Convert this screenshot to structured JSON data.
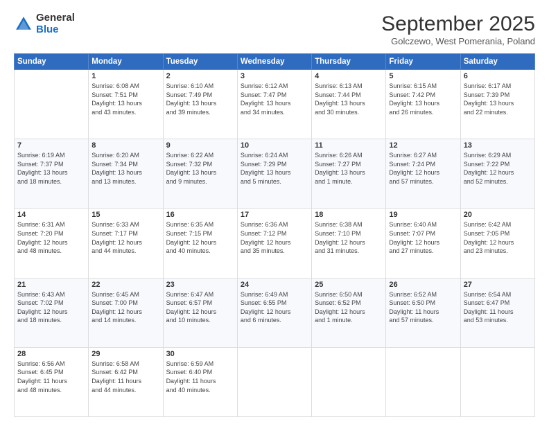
{
  "logo": {
    "general": "General",
    "blue": "Blue"
  },
  "header": {
    "month": "September 2025",
    "location": "Golczewo, West Pomerania, Poland"
  },
  "days_of_week": [
    "Sunday",
    "Monday",
    "Tuesday",
    "Wednesday",
    "Thursday",
    "Friday",
    "Saturday"
  ],
  "weeks": [
    [
      {
        "day": "",
        "info": ""
      },
      {
        "day": "1",
        "info": "Sunrise: 6:08 AM\nSunset: 7:51 PM\nDaylight: 13 hours\nand 43 minutes."
      },
      {
        "day": "2",
        "info": "Sunrise: 6:10 AM\nSunset: 7:49 PM\nDaylight: 13 hours\nand 39 minutes."
      },
      {
        "day": "3",
        "info": "Sunrise: 6:12 AM\nSunset: 7:47 PM\nDaylight: 13 hours\nand 34 minutes."
      },
      {
        "day": "4",
        "info": "Sunrise: 6:13 AM\nSunset: 7:44 PM\nDaylight: 13 hours\nand 30 minutes."
      },
      {
        "day": "5",
        "info": "Sunrise: 6:15 AM\nSunset: 7:42 PM\nDaylight: 13 hours\nand 26 minutes."
      },
      {
        "day": "6",
        "info": "Sunrise: 6:17 AM\nSunset: 7:39 PM\nDaylight: 13 hours\nand 22 minutes."
      }
    ],
    [
      {
        "day": "7",
        "info": "Sunrise: 6:19 AM\nSunset: 7:37 PM\nDaylight: 13 hours\nand 18 minutes."
      },
      {
        "day": "8",
        "info": "Sunrise: 6:20 AM\nSunset: 7:34 PM\nDaylight: 13 hours\nand 13 minutes."
      },
      {
        "day": "9",
        "info": "Sunrise: 6:22 AM\nSunset: 7:32 PM\nDaylight: 13 hours\nand 9 minutes."
      },
      {
        "day": "10",
        "info": "Sunrise: 6:24 AM\nSunset: 7:29 PM\nDaylight: 13 hours\nand 5 minutes."
      },
      {
        "day": "11",
        "info": "Sunrise: 6:26 AM\nSunset: 7:27 PM\nDaylight: 13 hours\nand 1 minute."
      },
      {
        "day": "12",
        "info": "Sunrise: 6:27 AM\nSunset: 7:24 PM\nDaylight: 12 hours\nand 57 minutes."
      },
      {
        "day": "13",
        "info": "Sunrise: 6:29 AM\nSunset: 7:22 PM\nDaylight: 12 hours\nand 52 minutes."
      }
    ],
    [
      {
        "day": "14",
        "info": "Sunrise: 6:31 AM\nSunset: 7:20 PM\nDaylight: 12 hours\nand 48 minutes."
      },
      {
        "day": "15",
        "info": "Sunrise: 6:33 AM\nSunset: 7:17 PM\nDaylight: 12 hours\nand 44 minutes."
      },
      {
        "day": "16",
        "info": "Sunrise: 6:35 AM\nSunset: 7:15 PM\nDaylight: 12 hours\nand 40 minutes."
      },
      {
        "day": "17",
        "info": "Sunrise: 6:36 AM\nSunset: 7:12 PM\nDaylight: 12 hours\nand 35 minutes."
      },
      {
        "day": "18",
        "info": "Sunrise: 6:38 AM\nSunset: 7:10 PM\nDaylight: 12 hours\nand 31 minutes."
      },
      {
        "day": "19",
        "info": "Sunrise: 6:40 AM\nSunset: 7:07 PM\nDaylight: 12 hours\nand 27 minutes."
      },
      {
        "day": "20",
        "info": "Sunrise: 6:42 AM\nSunset: 7:05 PM\nDaylight: 12 hours\nand 23 minutes."
      }
    ],
    [
      {
        "day": "21",
        "info": "Sunrise: 6:43 AM\nSunset: 7:02 PM\nDaylight: 12 hours\nand 18 minutes."
      },
      {
        "day": "22",
        "info": "Sunrise: 6:45 AM\nSunset: 7:00 PM\nDaylight: 12 hours\nand 14 minutes."
      },
      {
        "day": "23",
        "info": "Sunrise: 6:47 AM\nSunset: 6:57 PM\nDaylight: 12 hours\nand 10 minutes."
      },
      {
        "day": "24",
        "info": "Sunrise: 6:49 AM\nSunset: 6:55 PM\nDaylight: 12 hours\nand 6 minutes."
      },
      {
        "day": "25",
        "info": "Sunrise: 6:50 AM\nSunset: 6:52 PM\nDaylight: 12 hours\nand 1 minute."
      },
      {
        "day": "26",
        "info": "Sunrise: 6:52 AM\nSunset: 6:50 PM\nDaylight: 11 hours\nand 57 minutes."
      },
      {
        "day": "27",
        "info": "Sunrise: 6:54 AM\nSunset: 6:47 PM\nDaylight: 11 hours\nand 53 minutes."
      }
    ],
    [
      {
        "day": "28",
        "info": "Sunrise: 6:56 AM\nSunset: 6:45 PM\nDaylight: 11 hours\nand 48 minutes."
      },
      {
        "day": "29",
        "info": "Sunrise: 6:58 AM\nSunset: 6:42 PM\nDaylight: 11 hours\nand 44 minutes."
      },
      {
        "day": "30",
        "info": "Sunrise: 6:59 AM\nSunset: 6:40 PM\nDaylight: 11 hours\nand 40 minutes."
      },
      {
        "day": "",
        "info": ""
      },
      {
        "day": "",
        "info": ""
      },
      {
        "day": "",
        "info": ""
      },
      {
        "day": "",
        "info": ""
      }
    ]
  ]
}
